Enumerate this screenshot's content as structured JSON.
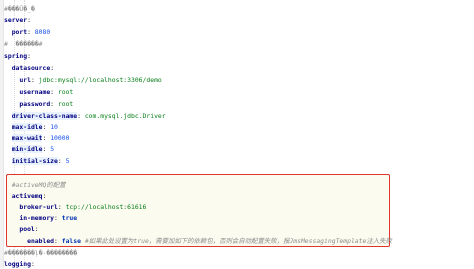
{
  "editor": {
    "lines": [
      {
        "indent": "",
        "key": "",
        "sep": "",
        "value": "#���Ū�_�",
        "type": "garbled"
      },
      {
        "indent": "",
        "key": "server",
        "sep": ":",
        "value": "",
        "type": "plain"
      },
      {
        "indent": "  ",
        "key": "port",
        "sep": ": ",
        "value": "8080",
        "type": "num"
      },
      {
        "indent": "",
        "key": "",
        "sep": "",
        "value": "#  ������#",
        "type": "garbled"
      },
      {
        "indent": "",
        "key": "spring",
        "sep": ":",
        "value": "",
        "type": "plain"
      },
      {
        "indent": "  ",
        "key": "datasource",
        "sep": ":",
        "value": "",
        "type": "plain"
      },
      {
        "indent": "    ",
        "key": "url",
        "sep": ": ",
        "value": "jdbc:mysql://localhost:3306/demo",
        "type": "str"
      },
      {
        "indent": "    ",
        "key": "username",
        "sep": ": ",
        "value": "root",
        "type": "str"
      },
      {
        "indent": "    ",
        "key": "password",
        "sep": ": ",
        "value": "root",
        "type": "str"
      },
      {
        "indent": "  ",
        "key": "driver-class-name",
        "sep": ": ",
        "value": "com.mysql.jdbc.Driver",
        "type": "str",
        "hl": true
      },
      {
        "indent": "  ",
        "key": "max-idle",
        "sep": ": ",
        "value": "10",
        "type": "num",
        "hl": true
      },
      {
        "indent": "  ",
        "key": "max-wait",
        "sep": ": ",
        "value": "10000",
        "type": "num",
        "hl": true
      },
      {
        "indent": "  ",
        "key": "min-idle",
        "sep": ": ",
        "value": "5",
        "type": "num",
        "hl": true
      },
      {
        "indent": "  ",
        "key": "initial-size",
        "sep": ": ",
        "value": "5",
        "type": "num",
        "hl": true
      },
      {
        "indent": "",
        "key": "",
        "sep": "",
        "value": "",
        "type": "blank"
      },
      {
        "indent": "  ",
        "key": "",
        "sep": "",
        "value": "#activeMQ的配置",
        "type": "comment"
      },
      {
        "indent": "  ",
        "key": "activemq",
        "sep": ":",
        "value": "",
        "type": "plain"
      },
      {
        "indent": "    ",
        "key": "broker-url",
        "sep": ": ",
        "value": "tcp://localhost:61616",
        "type": "str"
      },
      {
        "indent": "    ",
        "key": "in-memory",
        "sep": ": ",
        "value": "true",
        "type": "bool"
      },
      {
        "indent": "    ",
        "key": "pool",
        "sep": ":",
        "value": "",
        "type": "plain"
      },
      {
        "indent": "      ",
        "key": "enabled",
        "sep": ": ",
        "value": "false",
        "type": "bool",
        "comment": " #如果此处设置为true，需要加如下的依赖包，否则会自动配置失败，报JmsMessagingTemplate注入失败"
      },
      {
        "indent": "",
        "key": "",
        "sep": "",
        "value": "#�������ļ�·��������",
        "type": "garbled"
      },
      {
        "indent": "",
        "key": "logging",
        "sep": ":",
        "value": "",
        "type": "plain"
      }
    ]
  }
}
